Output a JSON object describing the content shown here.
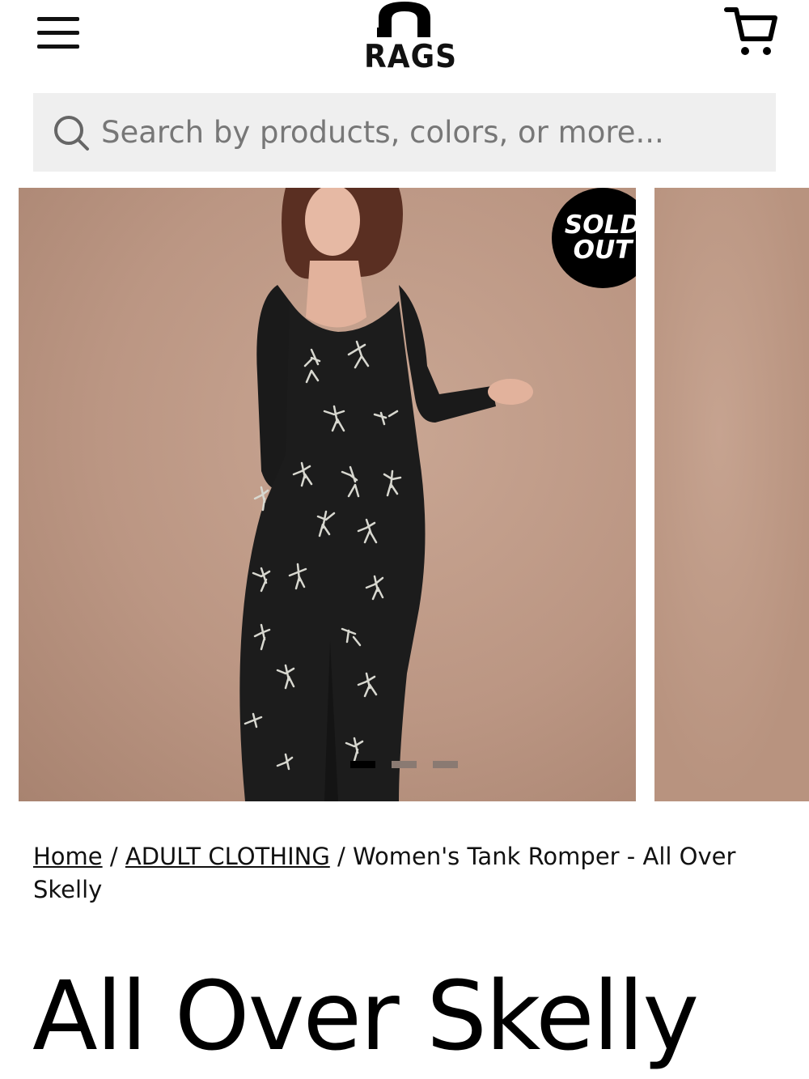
{
  "header": {
    "logo_text": "RAGS",
    "menu_icon": "hamburger-menu-icon",
    "cart_icon": "shopping-cart-icon"
  },
  "search": {
    "placeholder": "Search by products, colors, or more...",
    "icon": "search-icon"
  },
  "gallery": {
    "badge": {
      "line1": "SOLD",
      "line2": "OUT"
    },
    "dots": 3,
    "active_dot": 1
  },
  "breadcrumb": {
    "home": "Home",
    "sep1": "/",
    "category": "ADULT CLOTHING",
    "sep2": "/",
    "current": "Women's Tank Romper - All Over Skelly"
  },
  "product": {
    "title": "All Over Skelly"
  },
  "colors": {
    "accent": "#000000",
    "search_bg": "#efefef",
    "photo_bg": "#bb9683"
  }
}
